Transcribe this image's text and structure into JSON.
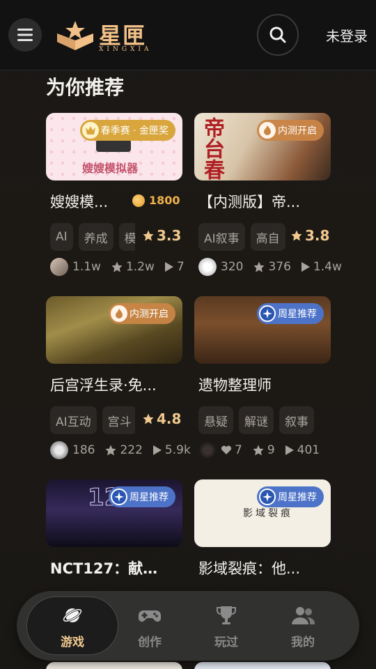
{
  "header": {
    "login_label": "未登录",
    "logo_text": "星匣",
    "logo_sub": "XINGXIA"
  },
  "section": {
    "title": "为你推荐"
  },
  "cards": [
    {
      "badge": "春季赛 · 金匣奖",
      "badge_type": "gold",
      "thumb_text": "嫂嫂模拟器",
      "title": "嫂嫂模...",
      "coins": "1800",
      "tags": [
        "AI",
        "养成",
        "模"
      ],
      "rating": "3.3",
      "stats": [
        "1.1w",
        "1.2w",
        "7"
      ]
    },
    {
      "badge": "内测开启",
      "badge_type": "orange",
      "thumb_text": "帝台春",
      "title": "【内测版】帝...",
      "tags": [
        "AI叙事",
        "高自"
      ],
      "rating": "3.8",
      "stats": [
        "320",
        "376",
        "1.4w"
      ]
    },
    {
      "badge": "内测开启",
      "badge_type": "orange",
      "thumb_text": "",
      "title": "后宫浮生录·免...",
      "tags": [
        "AI互动",
        "宫斗"
      ],
      "rating": "4.8",
      "stats": [
        "186",
        "222",
        "5.9k"
      ]
    },
    {
      "badge": "周星推荐",
      "badge_type": "blue",
      "thumb_text": "",
      "title": "遗物整理师",
      "tags": [
        "悬疑",
        "解谜",
        "叙事"
      ],
      "rating": "",
      "stats": [
        "7",
        "9",
        "401"
      ]
    },
    {
      "badge": "周星推荐",
      "badge_type": "blue",
      "thumb_text": "127",
      "title": "NCT127：献灯...",
      "tags": [],
      "rating": "",
      "stats": []
    },
    {
      "badge": "周星推荐",
      "badge_type": "blue",
      "thumb_text": "影域裂痕",
      "title": "影域裂痕：他...",
      "tags": [],
      "rating": "",
      "stats": []
    }
  ],
  "nav": [
    {
      "label": "游戏",
      "icon": "planet-icon",
      "active": true
    },
    {
      "label": "创作",
      "icon": "gamepad-icon",
      "active": false
    },
    {
      "label": "玩过",
      "icon": "trophy-icon",
      "active": false
    },
    {
      "label": "我的",
      "icon": "people-icon",
      "active": false
    }
  ],
  "colors": {
    "accent": "#f0c98e",
    "coin": "#f0b14a",
    "badge_blue": "#4d73c8",
    "badge_orange": "#c98546",
    "badge_gold": "#d8a63d"
  }
}
